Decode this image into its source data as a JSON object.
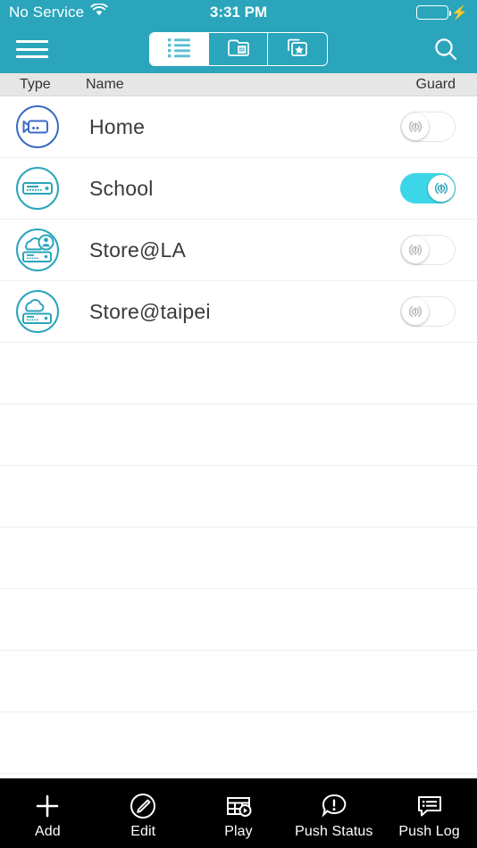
{
  "status_bar": {
    "carrier": "No Service",
    "wifi_icon": "wifi-icon",
    "time": "3:31 PM",
    "battery_icon": "battery-full-icon",
    "battery_level": 100,
    "charging_icon": "lightning-bolt-icon"
  },
  "nav_bar": {
    "menu_icon": "hamburger-menu-icon",
    "search_icon": "search-icon",
    "segments": [
      {
        "name": "list-view",
        "icon": "list-icon",
        "selected": true
      },
      {
        "name": "folder-view",
        "icon": "folder-icon",
        "selected": false
      },
      {
        "name": "favorites-view",
        "icon": "star-cards-icon",
        "selected": false
      }
    ]
  },
  "table_header": {
    "type": "Type",
    "name": "Name",
    "guard": "Guard"
  },
  "devices": [
    {
      "name": "Home",
      "type_icon": "camera-icon",
      "icon_color": "#3b6cc4",
      "guard_on": false
    },
    {
      "name": "School",
      "type_icon": "nvr-icon",
      "icon_color": "#2aa5bb",
      "guard_on": true
    },
    {
      "name": "Store@LA",
      "type_icon": "cloud-nvr-user-icon",
      "icon_color": "#2aa5bb",
      "guard_on": false
    },
    {
      "name": "Store@taipei",
      "type_icon": "cloud-nvr-icon",
      "icon_color": "#2aa5bb",
      "guard_on": false
    }
  ],
  "empty_row_count": 7,
  "tab_bar": [
    {
      "label": "Add",
      "icon": "plus-icon"
    },
    {
      "label": "Edit",
      "icon": "pencil-circle-icon"
    },
    {
      "label": "Play",
      "icon": "grid-play-icon"
    },
    {
      "label": "Push Status",
      "icon": "alert-bubble-icon"
    },
    {
      "label": "Push Log",
      "icon": "log-bubble-icon"
    }
  ],
  "colors": {
    "brand_teal": "#2aa5bb",
    "toggle_on": "#3dd6e8",
    "battery_green": "#4cd964",
    "header_gray": "#e6e6e6",
    "tab_bar_black": "#000000"
  }
}
